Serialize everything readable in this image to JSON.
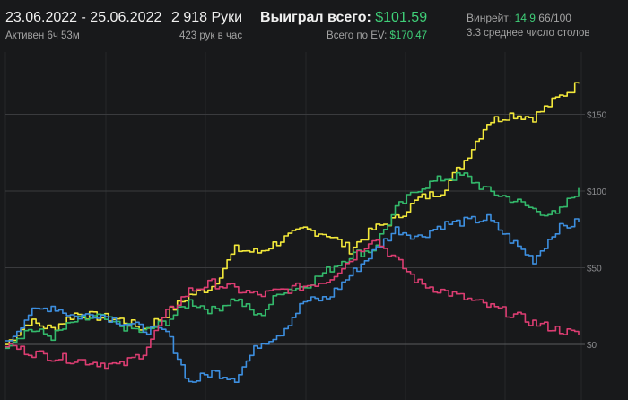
{
  "header": {
    "date_range": "23.06.2022 - 25.06.2022",
    "active_time": "Активен 6ч 53м",
    "hands_count": "2 918 Руки",
    "hands_per_hour": "423 рук в час",
    "won_total_label": "Выиграл всего:",
    "won_total_value": "$101.59",
    "ev_total_label": "Всего по EV:",
    "ev_total_value": "$170.47",
    "winrate_label": "Винрейт:",
    "winrate_value": "14.9",
    "winrate_hands": "66/100",
    "avg_tables": "3.3 среднее число столов"
  },
  "chart_data": {
    "type": "line",
    "ylim": [
      -25,
      175
    ],
    "y_ticks": [
      0,
      50,
      100,
      150
    ],
    "y_tick_labels": [
      "$0",
      "$50",
      "$100",
      "$150"
    ],
    "x_points": 26,
    "series": [
      {
        "color": "#f2e83a",
        "values": [
          0,
          15,
          10,
          20,
          18,
          16,
          10,
          20,
          32,
          38,
          62,
          60,
          68,
          75,
          72,
          62,
          75,
          82,
          95,
          100,
          120,
          145,
          150,
          148,
          160,
          170
        ]
      },
      {
        "color": "#33b96b",
        "values": [
          0,
          10,
          5,
          15,
          18,
          12,
          8,
          15,
          28,
          22,
          30,
          18,
          35,
          38,
          48,
          58,
          62,
          88,
          102,
          108,
          110,
          100,
          95,
          88,
          84,
          102
        ]
      },
      {
        "color": "#3d8fe0",
        "values": [
          0,
          20,
          25,
          18,
          20,
          15,
          10,
          8,
          -25,
          -18,
          -22,
          0,
          8,
          28,
          30,
          45,
          60,
          75,
          70,
          78,
          80,
          82,
          68,
          55,
          75,
          80
        ]
      },
      {
        "color": "#dc3d72",
        "values": [
          0,
          -5,
          -8,
          -10,
          -12,
          -14,
          -5,
          20,
          35,
          40,
          36,
          32,
          35,
          38,
          42,
          55,
          70,
          55,
          40,
          35,
          30,
          25,
          20,
          14,
          10,
          6
        ]
      }
    ]
  }
}
